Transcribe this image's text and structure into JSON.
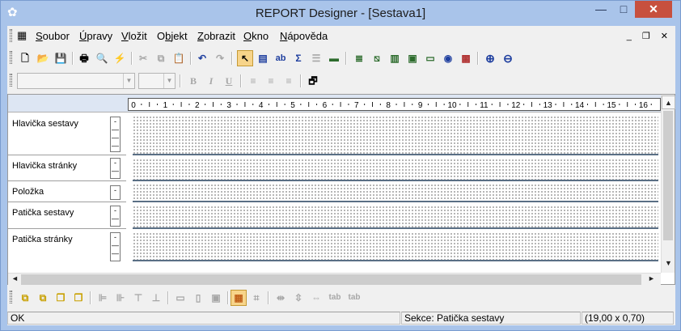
{
  "window": {
    "title": "REPORT Designer - [Sestava1]",
    "min_glyph": "—",
    "max_glyph": "□",
    "close_glyph": "✕",
    "app_icon_glyph": "✿"
  },
  "menubar": {
    "doc_icon_glyph": "▦",
    "items": [
      {
        "mnemonic": "S",
        "rest": "oubor"
      },
      {
        "mnemonic": "Ú",
        "rest": "pravy"
      },
      {
        "mnemonic": "V",
        "rest": "ložit"
      },
      {
        "mnemonic": "O",
        "rest": "bjekt",
        "prefix": "",
        "full": "Objekt"
      },
      {
        "mnemonic": "Z",
        "rest": "obrazit"
      },
      {
        "mnemonic": "O",
        "rest": "kno"
      },
      {
        "mnemonic": "N",
        "rest": "ápověda"
      }
    ],
    "mdi_controls": "_ ❐ ✕"
  },
  "toolbar_main": [
    {
      "icon": "new-doc-icon",
      "glyph": "🗋"
    },
    {
      "icon": "open-folder-icon",
      "glyph": "📂"
    },
    {
      "icon": "save-icon",
      "glyph": "💾"
    },
    {
      "icon": "print-icon",
      "glyph": "🖶"
    },
    {
      "icon": "print-preview-icon",
      "glyph": "🔍"
    },
    {
      "icon": "run-lightning-icon",
      "glyph": "⚡"
    },
    {
      "icon": "cut-icon",
      "glyph": "✂"
    },
    {
      "icon": "copy-icon",
      "glyph": "⧉"
    },
    {
      "icon": "paste-icon",
      "glyph": "📋"
    },
    {
      "icon": "undo-icon",
      "glyph": "↶"
    },
    {
      "icon": "redo-icon",
      "glyph": "↷"
    },
    {
      "icon": "pointer-icon",
      "glyph": "↖"
    },
    {
      "icon": "label-icon",
      "glyph": "▤"
    },
    {
      "icon": "text-field-icon",
      "glyph": "ab"
    },
    {
      "icon": "sum-icon",
      "glyph": "Σ"
    },
    {
      "icon": "list-icon",
      "glyph": "☰"
    },
    {
      "icon": "line-icon",
      "glyph": "▬"
    },
    {
      "icon": "section-icon-1",
      "glyph": "≣"
    },
    {
      "icon": "section-icon-2",
      "glyph": "⧅"
    },
    {
      "icon": "section-icon-3",
      "glyph": "▥"
    },
    {
      "icon": "section-icon-4",
      "glyph": "▣"
    },
    {
      "icon": "section-icon-5",
      "glyph": "▭"
    },
    {
      "icon": "section-icon-6",
      "glyph": "◉"
    },
    {
      "icon": "chart-icon",
      "glyph": "▩"
    },
    {
      "icon": "zoom-in-icon",
      "glyph": "⊕"
    },
    {
      "icon": "zoom-out-icon",
      "glyph": "⊖"
    }
  ],
  "toolbar_format": {
    "font_name": "",
    "font_size": "",
    "bold": "B",
    "italic": "I",
    "underline": "U",
    "align_left_glyph": "≡",
    "align_center_glyph": "≡",
    "align_right_glyph": "≡",
    "properties_glyph": "🗗"
  },
  "ruler": {
    "labels": [
      "0",
      "1",
      "2",
      "3",
      "4",
      "5",
      "6",
      "7",
      "8",
      "9",
      "10",
      "11",
      "12",
      "13",
      "14",
      "15",
      "16"
    ]
  },
  "sections": [
    {
      "name": "Hlavička sestavy",
      "mini": [
        "-",
        "—",
        "—",
        "—"
      ]
    },
    {
      "name": "Hlavička stránky",
      "mini": [
        "-",
        "—"
      ]
    },
    {
      "name": "Položka",
      "mini": [
        "-"
      ]
    },
    {
      "name": "Patička sestavy",
      "mini": [
        "-",
        "—"
      ]
    },
    {
      "name": "Patička stránky",
      "mini": [
        "-",
        "—",
        "—"
      ]
    }
  ],
  "scroll": {
    "up": "▲",
    "down": "▼",
    "left": "◄",
    "right": "►"
  },
  "toolbar_layout": [
    {
      "icon": "bring-front-icon",
      "glyph": "⧉"
    },
    {
      "icon": "send-back-icon",
      "glyph": "⧉"
    },
    {
      "icon": "bring-forward-icon",
      "glyph": "❐"
    },
    {
      "icon": "send-backward-icon",
      "glyph": "❐"
    },
    {
      "icon": "align-left-icon",
      "glyph": "⊫"
    },
    {
      "icon": "align-right-icon",
      "glyph": "⊪"
    },
    {
      "icon": "align-top-icon",
      "glyph": "⊤"
    },
    {
      "icon": "align-bottom-icon",
      "glyph": "⊥"
    },
    {
      "icon": "same-width-icon",
      "glyph": "▭"
    },
    {
      "icon": "same-height-icon",
      "glyph": "▯"
    },
    {
      "icon": "same-size-icon",
      "glyph": "▣"
    },
    {
      "icon": "grid-icon",
      "glyph": "▦"
    },
    {
      "icon": "frame-icon",
      "glyph": "⌗"
    },
    {
      "icon": "center-h-icon",
      "glyph": "⇹"
    },
    {
      "icon": "center-v-icon",
      "glyph": "⇳"
    },
    {
      "icon": "space-icon",
      "glyph": "⇔"
    },
    {
      "icon": "tab-h-icon",
      "glyph": "tab"
    },
    {
      "icon": "tab-v-icon",
      "glyph": "tab"
    }
  ],
  "status": {
    "left": "OK",
    "section": "Sekce: Patička sestavy",
    "size": "(19,00 x 0,70)"
  },
  "colors": {
    "frame": "#a9c4ea",
    "close": "#c7503e",
    "ruler_bg": "#dde6f3",
    "selected_tool": "#f7d48a"
  }
}
